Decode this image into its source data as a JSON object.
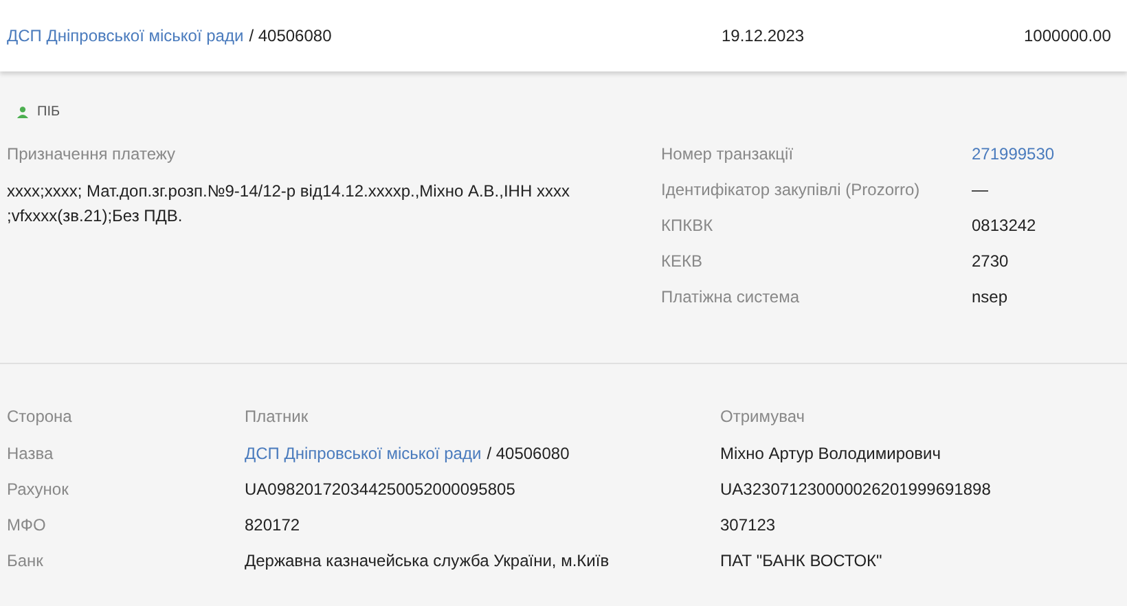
{
  "header": {
    "payer_link": "ДСП Дніпровської міської ради",
    "payer_code": "/ 40506080",
    "date": "19.12.2023",
    "amount": "1000000.00"
  },
  "tag": {
    "label": "ПІБ"
  },
  "purpose": {
    "label": "Призначення платежу",
    "text": "xxxx;xxxx; Мат.доп.зг.розп.№9-14/12-р від14.12.xxxxр.,Міхно А.В.,ІНН xxxx ;vfxxxx(зв.21);Без ПДВ."
  },
  "details": [
    {
      "label": "Номер транзакції",
      "value": "271999530",
      "kind": "link"
    },
    {
      "label": "Ідентифікатор закупівлі (Prozorro)",
      "value": "—",
      "kind": "text"
    },
    {
      "label": "КПКВК",
      "value": "0813242",
      "kind": "text"
    },
    {
      "label": "КЕКВ",
      "value": "2730",
      "kind": "text"
    },
    {
      "label": "Платіжна система",
      "value": "nsep",
      "kind": "text"
    }
  ],
  "parties": {
    "columns": [
      "Сторона",
      "Платник",
      "Отримувач"
    ],
    "rows": [
      {
        "label": "Назва",
        "payer": "ДСП Дніпровської міської ради",
        "payer_suffix": "/ 40506080",
        "kind": "link",
        "recipient": "Міхно Артур Володимирович"
      },
      {
        "label": "Рахунок",
        "payer": "UA098201720344250052000095805",
        "kind": "text",
        "recipient": "UA323071230000026201999691898"
      },
      {
        "label": "МФО",
        "payer": "820172",
        "kind": "text",
        "recipient": "307123"
      },
      {
        "label": "Банк",
        "payer": "Державна казначейська служба України, м.Київ",
        "kind": "text",
        "recipient": "ПАТ \"БАНК ВОСТОК\""
      }
    ]
  }
}
